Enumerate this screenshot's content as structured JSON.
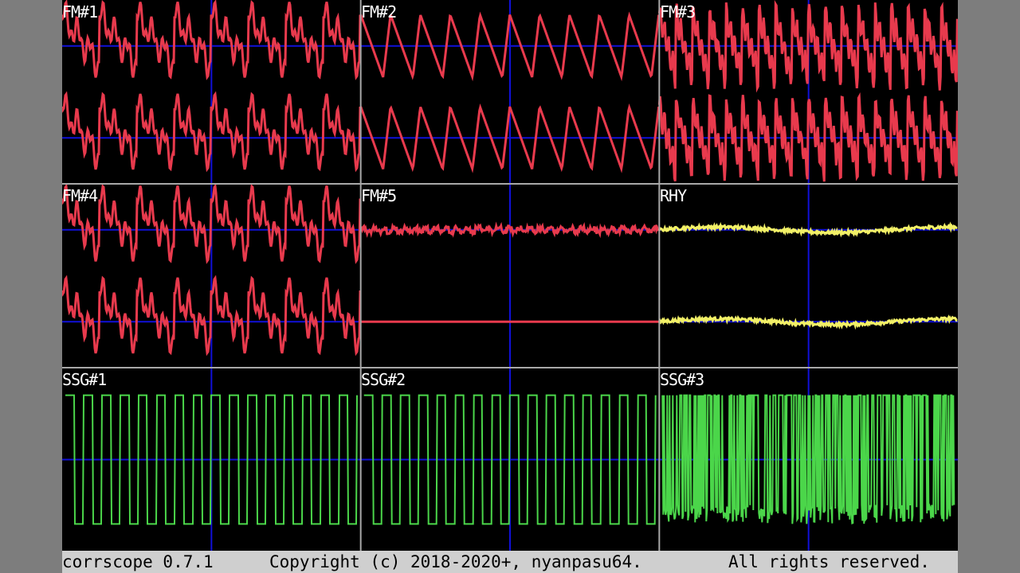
{
  "app": {
    "name": "corrscope"
  },
  "footer": {
    "version": "corrscope 0.7.1",
    "copyright": "Copyright (c) 2018-2020+, nyanpasu64.",
    "rights": "All rights reserved."
  },
  "colors": {
    "fm": "#e83a4d",
    "rhythm": "#f2f067",
    "ssg": "#4bd64a",
    "midline": "#1010d8",
    "grid": "#a8a8a8",
    "background": "#000000"
  },
  "channels": [
    {
      "name": "FM#1",
      "wave": "fm-complex",
      "color_key": "fm"
    },
    {
      "name": "FM#2",
      "wave": "fm-saw",
      "color_key": "fm"
    },
    {
      "name": "FM#3",
      "wave": "fm-dense",
      "color_key": "fm"
    },
    {
      "name": "FM#4",
      "wave": "fm-complex",
      "color_key": "fm"
    },
    {
      "name": "FM#5",
      "wave": "fm-buzz",
      "color_key": "fm"
    },
    {
      "name": "RHY",
      "wave": "noise-low",
      "color_key": "rhythm"
    },
    {
      "name": "SSG#1",
      "wave": "square",
      "color_key": "ssg"
    },
    {
      "name": "SSG#2",
      "wave": "square",
      "color_key": "ssg"
    },
    {
      "name": "SSG#3",
      "wave": "noise-dense",
      "color_key": "ssg"
    }
  ]
}
